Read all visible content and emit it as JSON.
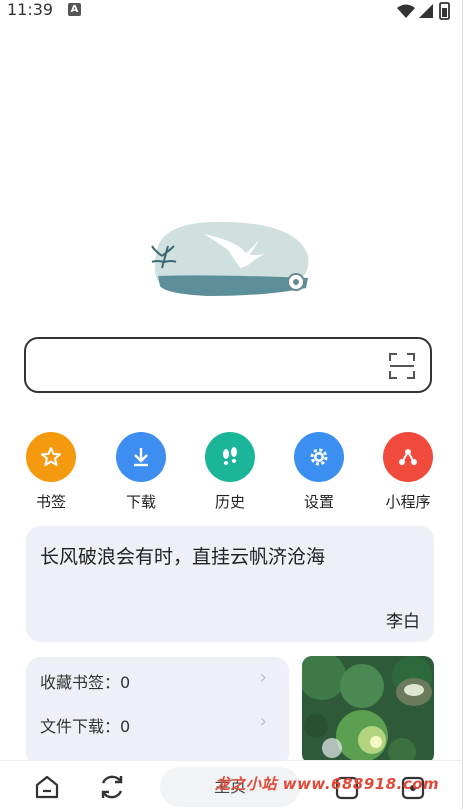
{
  "status_bar": {
    "time": "11:39",
    "notif_letter": "A"
  },
  "search": {
    "placeholder": ""
  },
  "quick_links": [
    {
      "label": "书签",
      "icon": "star-icon",
      "color": "#f59a0f"
    },
    {
      "label": "下载",
      "icon": "download-icon",
      "color": "#3d8ef0"
    },
    {
      "label": "历史",
      "icon": "footprints-icon",
      "color": "#1bb59a"
    },
    {
      "label": "设置",
      "icon": "gear-icon",
      "color": "#3a8ff0"
    },
    {
      "label": "小程序",
      "icon": "mini-program-icon",
      "color": "#ef4a3c"
    }
  ],
  "quote": {
    "text": "长风破浪会有时，直挂云帆济沧海",
    "author": "李白"
  },
  "stats": [
    {
      "label": "收藏书签：0"
    },
    {
      "label": "文件下载：0"
    }
  ],
  "bottom_nav": {
    "home_label": "主页"
  },
  "watermark": "龙之小站 www.688918.com"
}
